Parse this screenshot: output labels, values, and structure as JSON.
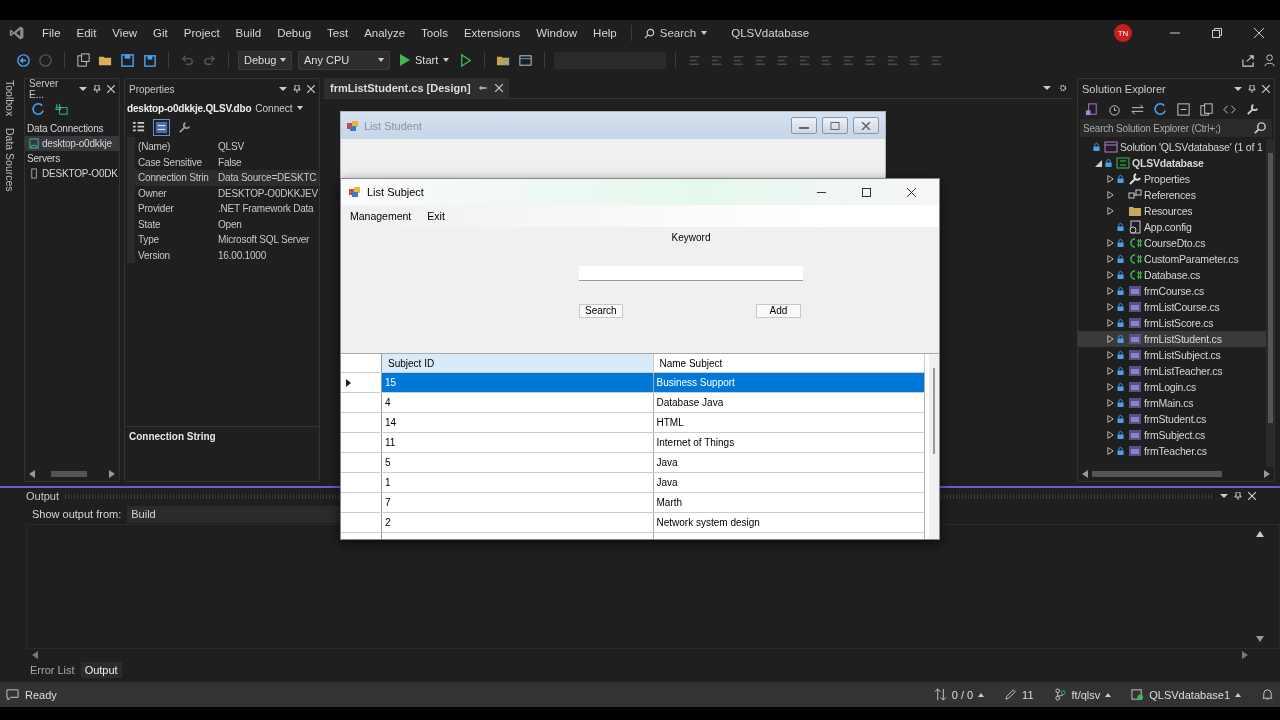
{
  "menu": [
    "File",
    "Edit",
    "View",
    "Git",
    "Project",
    "Build",
    "Debug",
    "Test",
    "Analyze",
    "Tools",
    "Extensions",
    "Window",
    "Help"
  ],
  "search": {
    "label": "Search"
  },
  "title": "QLSVdatabase",
  "avatar": "TN",
  "toolbar": {
    "configuration": "Debug",
    "platform": "Any CPU",
    "start": "Start"
  },
  "left_tabs": [
    "Toolbox",
    "Data Sources"
  ],
  "server_explorer": {
    "title": "Server E...",
    "tree": [
      {
        "label": "Data Connections",
        "selected": false,
        "children": [
          {
            "label": "desktop-o0dkkje",
            "kind": "connection",
            "selected": true
          }
        ]
      },
      {
        "label": "Servers",
        "selected": false,
        "children": [
          {
            "label": "DESKTOP-O0DK",
            "kind": "server",
            "selected": false
          }
        ]
      }
    ]
  },
  "properties": {
    "title": "Properties",
    "object": "desktop-o0dkkje.QLSV.dbo",
    "object_action": "Connect",
    "rows": [
      {
        "name": "(Name)",
        "value": "QLSV",
        "selected": false
      },
      {
        "name": "Case Sensitive",
        "value": "False",
        "selected": false
      },
      {
        "name": "Connection Strin",
        "value": "Data Source=DESKTC",
        "selected": true
      },
      {
        "name": "Owner",
        "value": "DESKTOP-O0DKKJEV",
        "selected": false
      },
      {
        "name": "Provider",
        "value": ".NET Framework Data",
        "selected": false
      },
      {
        "name": "State",
        "value": "Open",
        "selected": false
      },
      {
        "name": "Type",
        "value": "Microsoft SQL Server",
        "selected": false
      },
      {
        "name": "Version",
        "value": "16.00.1000",
        "selected": false
      }
    ],
    "description_title": "Connection String"
  },
  "designer": {
    "tab": "frmListStudent.cs [Design]",
    "form_title": "List Student"
  },
  "dialog": {
    "title": "List Subject",
    "menu": [
      "Management",
      "Exit"
    ],
    "keyword_label": "Keyword",
    "buttons": [
      "Search",
      "Add"
    ],
    "grid": {
      "columns": [
        "Subject ID",
        "Name Subject"
      ],
      "rows": [
        {
          "cells": [
            "15",
            "Business Support"
          ],
          "selected": true
        },
        {
          "cells": [
            "4",
            "Database Java"
          ],
          "selected": false
        },
        {
          "cells": [
            "14",
            "HTML"
          ],
          "selected": false
        },
        {
          "cells": [
            "11",
            "Internet of Things"
          ],
          "selected": false
        },
        {
          "cells": [
            "5",
            "Java"
          ],
          "selected": false
        },
        {
          "cells": [
            "1",
            "Java"
          ],
          "selected": false
        },
        {
          "cells": [
            "7",
            "Marth"
          ],
          "selected": false
        },
        {
          "cells": [
            "2",
            "Network system design"
          ],
          "selected": false
        }
      ]
    }
  },
  "solution_explorer": {
    "title": "Solution Explorer",
    "search": {
      "placeholder": "Search Solution Explorer (Ctrl+;)"
    },
    "tree": [
      {
        "label": "Solution 'QLSVdatabase' (1 of 1",
        "kind": "solution",
        "locked": true,
        "selected": false,
        "children": [
          {
            "label": "QLSVdatabase",
            "kind": "project",
            "locked": true,
            "expanded": true,
            "selected": false,
            "children": [
              {
                "label": "Properties",
                "kind": "properties",
                "locked": true,
                "expanded": false,
                "selected": false
              },
              {
                "label": "References",
                "kind": "references",
                "locked": false,
                "expanded": false,
                "selected": false
              },
              {
                "label": "Resources",
                "kind": "folder",
                "locked": false,
                "expanded": false,
                "selected": false
              },
              {
                "label": "App.config",
                "kind": "config",
                "locked": true,
                "selected": false
              },
              {
                "label": "CourseDto.cs",
                "kind": "class",
                "locked": true,
                "expanded": false,
                "selected": false
              },
              {
                "label": "CustomParameter.cs",
                "kind": "class",
                "locked": true,
                "expanded": false,
                "selected": false
              },
              {
                "label": "Database.cs",
                "kind": "class",
                "locked": true,
                "expanded": false,
                "selected": false
              },
              {
                "label": "frmCourse.cs",
                "kind": "form",
                "locked": true,
                "expanded": false,
                "selected": false
              },
              {
                "label": "frmListCourse.cs",
                "kind": "form",
                "locked": true,
                "expanded": false,
                "selected": false
              },
              {
                "label": "frmListScore.cs",
                "kind": "form",
                "locked": true,
                "expanded": false,
                "selected": false
              },
              {
                "label": "frmListStudent.cs",
                "kind": "form",
                "locked": true,
                "expanded": false,
                "selected": true
              },
              {
                "label": "frmListSubject.cs",
                "kind": "form",
                "locked": true,
                "expanded": false,
                "selected": false
              },
              {
                "label": "frmListTeacher.cs",
                "kind": "form",
                "locked": true,
                "expanded": false,
                "selected": false
              },
              {
                "label": "frmLogin.cs",
                "kind": "form",
                "locked": true,
                "expanded": false,
                "selected": false
              },
              {
                "label": "frmMain.cs",
                "kind": "form",
                "locked": true,
                "expanded": false,
                "selected": false
              },
              {
                "label": "frmStudent.cs",
                "kind": "form",
                "locked": true,
                "expanded": false,
                "selected": false
              },
              {
                "label": "frmSubject.cs",
                "kind": "form",
                "locked": true,
                "expanded": false,
                "selected": false
              },
              {
                "label": "frmTeacher.cs",
                "kind": "form",
                "locked": true,
                "expanded": false,
                "selected": false
              }
            ]
          }
        ]
      }
    ]
  },
  "output": {
    "title": "Output",
    "source_label": "Show output from:",
    "source": "Build",
    "tabs": [
      {
        "label": "Error List",
        "selected": false
      },
      {
        "label": "Output",
        "selected": true
      }
    ]
  },
  "status": {
    "text": "Ready",
    "changes": "0 / 0",
    "edits": "11",
    "branch": "ft/qlsv",
    "repo": "QLSVdatabase1"
  }
}
